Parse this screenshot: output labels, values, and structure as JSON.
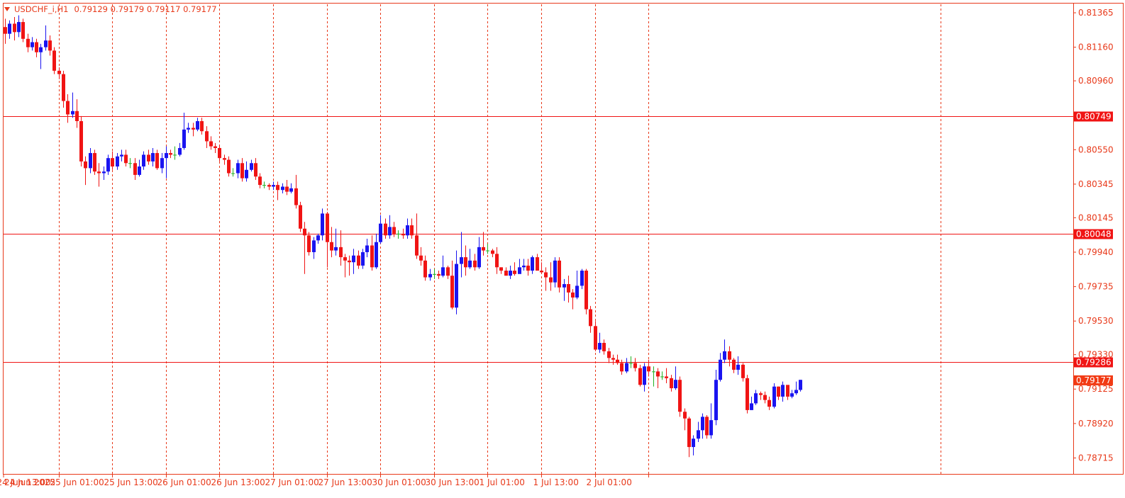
{
  "header": {
    "symbol": "USDCHF_i,H1",
    "ohlc": "0.79129 0.79179 0.79117 0.79177"
  },
  "colors": {
    "frame": "#e8391a",
    "bull": "#1a14f0",
    "bear": "#f01414",
    "doji": "#22b022",
    "level_line": "#f01414",
    "current_price_bg": "#f23a14",
    "grid": "#e8391a"
  },
  "chart_data": {
    "type": "candlestick",
    "title": "USDCHF_i,H1",
    "timeframe": "H1",
    "ylim": [
      0.7862,
      0.8142
    ],
    "y_ticks": [
      "0.81365",
      "0.81160",
      "0.80960",
      "0.80550",
      "0.80345",
      "0.80145",
      "0.79940",
      "0.79735",
      "0.79530",
      "0.79330",
      "0.79125",
      "0.78920",
      "0.78715"
    ],
    "x_ticks": [
      "24 Jun 2025",
      "24 Jun 13:00",
      "25 Jun 01:00",
      "25 Jun 13:00",
      "26 Jun 01:00",
      "26 Jun 13:00",
      "27 Jun 01:00",
      "27 Jun 13:00",
      "30 Jun 01:00",
      "30 Jun 13:00",
      "1 Jul 01:00",
      "1 Jul 13:00",
      "2 Jul 01:00"
    ],
    "grid": "vertical dotted lines",
    "horizontal_levels": [
      "0.80749",
      "0.80048",
      "0.79286"
    ],
    "current_price": "0.79177",
    "candles": [
      [
        0.8128,
        0.8124,
        0.8133,
        0.8118
      ],
      [
        0.8124,
        0.813,
        0.8132,
        0.8121
      ],
      [
        0.813,
        0.8125,
        0.8134,
        0.812
      ],
      [
        0.8125,
        0.8131,
        0.8135,
        0.8122
      ],
      [
        0.8131,
        0.8121,
        0.8133,
        0.8119
      ],
      [
        0.8121,
        0.8116,
        0.8124,
        0.8113
      ],
      [
        0.8116,
        0.8119,
        0.8122,
        0.8114
      ],
      [
        0.8119,
        0.8113,
        0.8121,
        0.811
      ],
      [
        0.8113,
        0.8116,
        0.8118,
        0.8103
      ],
      [
        0.8116,
        0.812,
        0.8129,
        0.8114
      ],
      [
        0.812,
        0.8114,
        0.8123,
        0.8111
      ],
      [
        0.8114,
        0.8102,
        0.8116,
        0.81
      ],
      [
        0.8102,
        0.81,
        0.8104,
        0.8097
      ],
      [
        0.81,
        0.8084,
        0.8102,
        0.808
      ],
      [
        0.8084,
        0.8076,
        0.8088,
        0.8071
      ],
      [
        0.8076,
        0.8078,
        0.8089,
        0.8074
      ],
      [
        0.8078,
        0.8072,
        0.8085,
        0.8068
      ],
      [
        0.8072,
        0.8048,
        0.8075,
        0.8045
      ],
      [
        0.8048,
        0.8044,
        0.8051,
        0.8034
      ],
      [
        0.8044,
        0.8053,
        0.8056,
        0.8041
      ],
      [
        0.8053,
        0.8042,
        0.8055,
        0.804
      ],
      [
        0.8042,
        0.8041,
        0.8047,
        0.8033
      ],
      [
        0.8041,
        0.8042,
        0.8045,
        0.8037
      ],
      [
        0.8042,
        0.805,
        0.8052,
        0.804
      ],
      [
        0.805,
        0.8045,
        0.8054,
        0.8043
      ],
      [
        0.8045,
        0.8051,
        0.8053,
        0.8043
      ],
      [
        0.8051,
        0.8052,
        0.8055,
        0.8048
      ],
      [
        0.8052,
        0.8047,
        0.8055,
        0.8045
      ],
      [
        0.8047,
        0.8047,
        0.805,
        0.8044
      ],
      [
        0.8047,
        0.804,
        0.805,
        0.8037
      ],
      [
        0.804,
        0.8045,
        0.8049,
        0.8039
      ],
      [
        0.8045,
        0.8052,
        0.8054,
        0.8043
      ],
      [
        0.8052,
        0.8048,
        0.8055,
        0.8046
      ],
      [
        0.8048,
        0.8053,
        0.8056,
        0.8045
      ],
      [
        0.8053,
        0.8044,
        0.8055,
        0.8043
      ],
      [
        0.8044,
        0.805,
        0.8053,
        0.8041
      ],
      [
        0.805,
        0.8053,
        0.8057,
        0.8038
      ],
      [
        0.8053,
        0.8052,
        0.8055,
        0.805
      ],
      [
        0.8052,
        0.8052,
        0.8057,
        0.8049
      ],
      [
        0.8052,
        0.8056,
        0.8059,
        0.8051
      ],
      [
        0.8056,
        0.8067,
        0.8077,
        0.8055
      ],
      [
        0.8067,
        0.8068,
        0.8071,
        0.8065
      ],
      [
        0.8068,
        0.8067,
        0.8071,
        0.8063
      ],
      [
        0.8067,
        0.8072,
        0.8074,
        0.8066
      ],
      [
        0.8072,
        0.8066,
        0.8074,
        0.8064
      ],
      [
        0.8066,
        0.806,
        0.8069,
        0.8056
      ],
      [
        0.806,
        0.8057,
        0.8063,
        0.8055
      ],
      [
        0.8057,
        0.8056,
        0.8059,
        0.8053
      ],
      [
        0.8056,
        0.805,
        0.8058,
        0.8048
      ],
      [
        0.805,
        0.8049,
        0.8052,
        0.8046
      ],
      [
        0.8049,
        0.8041,
        0.8051,
        0.8039
      ],
      [
        0.8041,
        0.8041,
        0.8044,
        0.8039
      ],
      [
        0.8041,
        0.8047,
        0.8049,
        0.8038
      ],
      [
        0.8047,
        0.8038,
        0.805,
        0.8036
      ],
      [
        0.8038,
        0.8043,
        0.8048,
        0.8036
      ],
      [
        0.8043,
        0.8047,
        0.8049,
        0.8042
      ],
      [
        0.8047,
        0.8039,
        0.805,
        0.8037
      ],
      [
        0.8039,
        0.8034,
        0.8041,
        0.8032
      ],
      [
        0.8034,
        0.8034,
        0.8036,
        0.8032
      ],
      [
        0.8034,
        0.8033,
        0.8035,
        0.8031
      ],
      [
        0.8033,
        0.8034,
        0.8036,
        0.8031
      ],
      [
        0.8034,
        0.8031,
        0.8036,
        0.8025
      ],
      [
        0.8031,
        0.8033,
        0.8035,
        0.8029
      ],
      [
        0.8033,
        0.803,
        0.8037,
        0.8028
      ],
      [
        0.803,
        0.8032,
        0.8035,
        0.8029
      ],
      [
        0.8032,
        0.8022,
        0.804,
        0.802
      ],
      [
        0.8022,
        0.8008,
        0.8024,
        0.8006
      ],
      [
        0.8008,
        0.8004,
        0.8012,
        0.7981
      ],
      [
        0.8004,
        0.7994,
        0.8006,
        0.7992
      ],
      [
        0.7994,
        0.8001,
        0.8003,
        0.799
      ],
      [
        0.8001,
        0.8004,
        0.8005,
        0.7999
      ],
      [
        0.8004,
        0.8017,
        0.802,
        0.8001
      ],
      [
        0.8017,
        0.8,
        0.8018,
        0.7985
      ],
      [
        0.8,
        0.7995,
        0.8009,
        0.7991
      ],
      [
        0.7995,
        0.7997,
        0.8008,
        0.7992
      ],
      [
        0.7997,
        0.7991,
        0.8007,
        0.7986
      ],
      [
        0.7991,
        0.7989,
        0.7993,
        0.7979
      ],
      [
        0.7989,
        0.7988,
        0.7992,
        0.798
      ],
      [
        0.7988,
        0.7992,
        0.7996,
        0.7981
      ],
      [
        0.7992,
        0.7986,
        0.7995,
        0.7984
      ],
      [
        0.7986,
        0.7994,
        0.7996,
        0.7984
      ],
      [
        0.7994,
        0.7998,
        0.8002,
        0.7991
      ],
      [
        0.7998,
        0.7985,
        0.8004,
        0.7983
      ],
      [
        0.7985,
        0.8,
        0.8005,
        0.7984
      ],
      [
        0.8,
        0.8011,
        0.8016,
        0.7999
      ],
      [
        0.8011,
        0.8004,
        0.8014,
        0.8002
      ],
      [
        0.8004,
        0.8009,
        0.8016,
        0.8002
      ],
      [
        0.8009,
        0.8005,
        0.8012,
        0.8003
      ],
      [
        0.8005,
        0.8005,
        0.8007,
        0.8002
      ],
      [
        0.8005,
        0.8004,
        0.8008,
        0.8002
      ],
      [
        0.8004,
        0.801,
        0.8014,
        0.8002
      ],
      [
        0.801,
        0.8004,
        0.8014,
        0.8002
      ],
      [
        0.8004,
        0.7992,
        0.8017,
        0.799
      ],
      [
        0.7992,
        0.7989,
        0.7997,
        0.7986
      ],
      [
        0.7989,
        0.7979,
        0.7992,
        0.7977
      ],
      [
        0.7979,
        0.7981,
        0.7984,
        0.7977
      ],
      [
        0.7981,
        0.7981,
        0.7984,
        0.7978
      ],
      [
        0.7981,
        0.798,
        0.7983,
        0.7978
      ],
      [
        0.798,
        0.7985,
        0.7992,
        0.7979
      ],
      [
        0.7985,
        0.798,
        0.7986,
        0.7978
      ],
      [
        0.798,
        0.7961,
        0.7989,
        0.796
      ],
      [
        0.7961,
        0.7987,
        0.7995,
        0.7957
      ],
      [
        0.7987,
        0.7991,
        0.8006,
        0.7979
      ],
      [
        0.7991,
        0.7985,
        0.7998,
        0.798
      ],
      [
        0.7985,
        0.7989,
        0.7996,
        0.7984
      ],
      [
        0.7989,
        0.7985,
        0.7993,
        0.7983
      ],
      [
        0.7985,
        0.7997,
        0.8003,
        0.7984
      ],
      [
        0.7997,
        0.7995,
        0.8006,
        0.7992
      ],
      [
        0.7995,
        0.7995,
        0.7999,
        0.7993
      ],
      [
        0.7995,
        0.7993,
        0.7996,
        0.7991
      ],
      [
        0.7993,
        0.7985,
        0.7997,
        0.7981
      ],
      [
        0.7985,
        0.7983,
        0.7985,
        0.7981
      ],
      [
        0.7983,
        0.798,
        0.7985,
        0.798
      ],
      [
        0.798,
        0.7983,
        0.7986,
        0.7978
      ],
      [
        0.7983,
        0.7981,
        0.7988,
        0.798
      ],
      [
        0.7981,
        0.7985,
        0.799,
        0.7983
      ],
      [
        0.7985,
        0.7986,
        0.799,
        0.7983
      ],
      [
        0.7986,
        0.7983,
        0.799,
        0.798
      ],
      [
        0.7983,
        0.7991,
        0.7992,
        0.7981
      ],
      [
        0.7991,
        0.7983,
        0.7993,
        0.7983
      ],
      [
        0.7983,
        0.7982,
        0.7988,
        0.7981
      ],
      [
        0.7982,
        0.7979,
        0.7985,
        0.7971
      ],
      [
        0.7979,
        0.7976,
        0.7988,
        0.7971
      ],
      [
        0.7976,
        0.7989,
        0.7991,
        0.7973
      ],
      [
        0.7989,
        0.7973,
        0.7991,
        0.797
      ],
      [
        0.7973,
        0.7975,
        0.7978,
        0.7965
      ],
      [
        0.7975,
        0.797,
        0.798,
        0.7964
      ],
      [
        0.797,
        0.7967,
        0.7972,
        0.796
      ],
      [
        0.7967,
        0.7974,
        0.7983,
        0.7966
      ],
      [
        0.7974,
        0.7983,
        0.7984,
        0.7972
      ],
      [
        0.7983,
        0.796,
        0.7984,
        0.7957
      ],
      [
        0.796,
        0.795,
        0.7962,
        0.7946
      ],
      [
        0.795,
        0.7936,
        0.7953,
        0.7935
      ],
      [
        0.7936,
        0.794,
        0.7946,
        0.7934
      ],
      [
        0.794,
        0.7935,
        0.7942,
        0.7933
      ],
      [
        0.7935,
        0.7931,
        0.7937,
        0.7928
      ],
      [
        0.7931,
        0.793,
        0.7933,
        0.7927
      ],
      [
        0.793,
        0.7928,
        0.7933,
        0.7927
      ],
      [
        0.7928,
        0.7923,
        0.793,
        0.7921
      ],
      [
        0.7923,
        0.7928,
        0.7931,
        0.7922
      ],
      [
        0.7928,
        0.7928,
        0.7932,
        0.7925
      ],
      [
        0.7928,
        0.7925,
        0.7931,
        0.7923
      ],
      [
        0.7925,
        0.7915,
        0.7927,
        0.7914
      ],
      [
        0.7915,
        0.7926,
        0.7928,
        0.7911
      ],
      [
        0.7926,
        0.7923,
        0.793,
        0.792
      ],
      [
        0.7923,
        0.7923,
        0.7926,
        0.7914
      ],
      [
        0.7923,
        0.792,
        0.7925,
        0.7913
      ],
      [
        0.792,
        0.792,
        0.7923,
        0.7918
      ],
      [
        0.792,
        0.7919,
        0.7925,
        0.7916
      ],
      [
        0.7919,
        0.7913,
        0.7921,
        0.7911
      ],
      [
        0.7913,
        0.7918,
        0.7926,
        0.7912
      ],
      [
        0.7918,
        0.7899,
        0.792,
        0.7896
      ],
      [
        0.7899,
        0.7895,
        0.7901,
        0.7888
      ],
      [
        0.7895,
        0.7878,
        0.7896,
        0.7872
      ],
      [
        0.7878,
        0.7883,
        0.7885,
        0.7873
      ],
      [
        0.7883,
        0.7888,
        0.7893,
        0.7881
      ],
      [
        0.7888,
        0.7896,
        0.7898,
        0.7883
      ],
      [
        0.7896,
        0.7885,
        0.7897,
        0.7883
      ],
      [
        0.7885,
        0.7894,
        0.7904,
        0.7883
      ],
      [
        0.7894,
        0.7918,
        0.7924,
        0.7891
      ],
      [
        0.7918,
        0.793,
        0.7934,
        0.7917
      ],
      [
        0.793,
        0.7935,
        0.7942,
        0.7928
      ],
      [
        0.7935,
        0.793,
        0.7938,
        0.7926
      ],
      [
        0.793,
        0.7924,
        0.7931,
        0.7922
      ],
      [
        0.7924,
        0.7927,
        0.7932,
        0.7921
      ],
      [
        0.7927,
        0.7919,
        0.7928,
        0.7917
      ],
      [
        0.7919,
        0.79,
        0.7921,
        0.7898
      ],
      [
        0.79,
        0.7904,
        0.7908,
        0.79
      ],
      [
        0.7904,
        0.791,
        0.7912,
        0.7903
      ],
      [
        0.791,
        0.7909,
        0.7911,
        0.7906
      ],
      [
        0.7909,
        0.7906,
        0.7911,
        0.7904
      ],
      [
        0.7906,
        0.7902,
        0.7908,
        0.79
      ],
      [
        0.7902,
        0.7914,
        0.7916,
        0.7901
      ],
      [
        0.7914,
        0.7908,
        0.7914,
        0.7906
      ],
      [
        0.7908,
        0.7915,
        0.7917,
        0.7905
      ],
      [
        0.7915,
        0.7908,
        0.7913,
        0.7906
      ],
      [
        0.7908,
        0.791,
        0.7912,
        0.7907
      ],
      [
        0.791,
        0.7912,
        0.7917,
        0.7909
      ],
      [
        0.7912,
        0.7918,
        0.7918,
        0.7911
      ]
    ]
  }
}
